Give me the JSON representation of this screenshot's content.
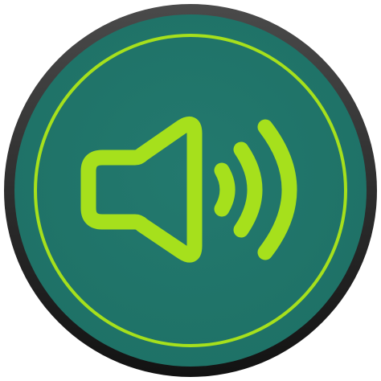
{
  "icon": {
    "name": "speaker-volume-icon",
    "colors": {
      "background": "#ffffff",
      "bezel_dark": "#1a1a1a",
      "bezel_mid": "#3a3a3a",
      "face": "#21776c",
      "accent": "#a6e01c"
    }
  }
}
